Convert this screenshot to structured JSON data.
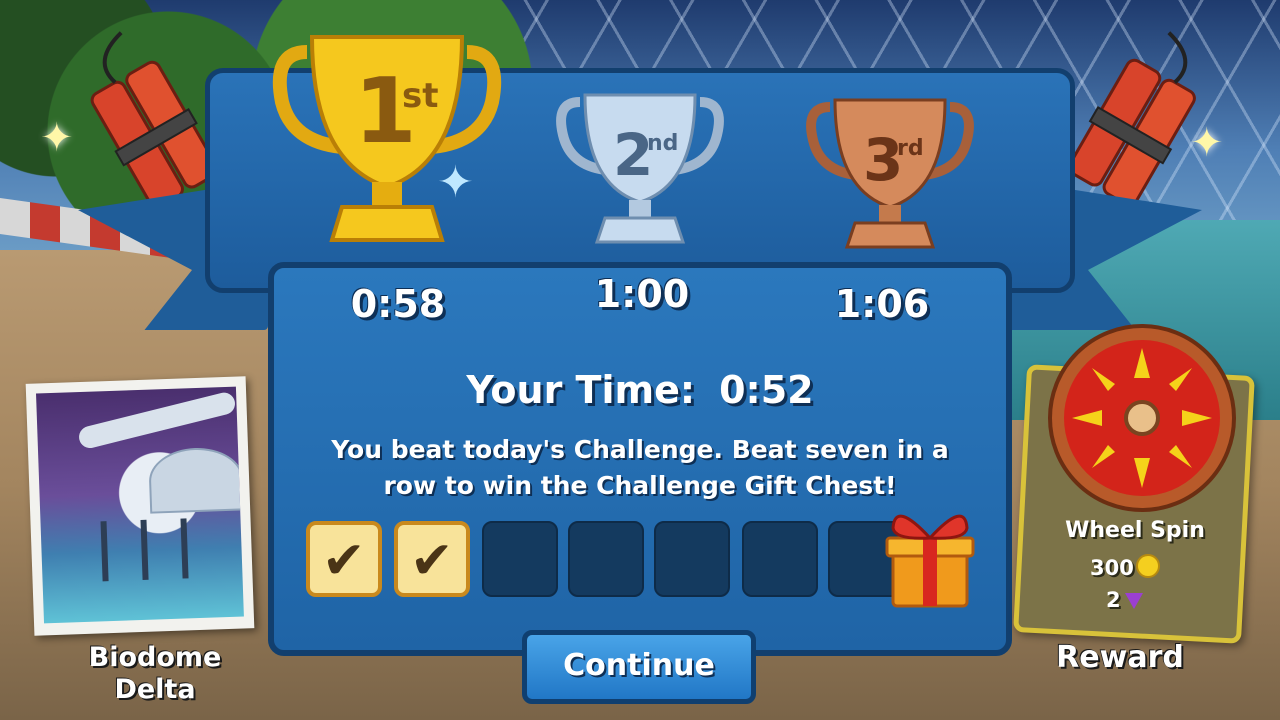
{
  "trophies": [
    {
      "rank": "1st",
      "num": "1",
      "suffix": "st",
      "time": "0:58",
      "color": "#f2c21b"
    },
    {
      "rank": "2nd",
      "num": "2",
      "suffix": "nd",
      "time": "1:00",
      "color": "#b9cfe6"
    },
    {
      "rank": "3rd",
      "num": "3",
      "suffix": "rd",
      "time": "1:06",
      "color": "#c9764a"
    }
  ],
  "result": {
    "your_time_label": "Your Time:",
    "your_time_value": "0:52",
    "message": "You beat today's Challenge.  Beat seven in a row to win the Challenge Gift Chest!"
  },
  "streak": {
    "completed": 2,
    "total": 7
  },
  "continue_label": "Continue",
  "track": {
    "name_line1": "Biodome",
    "name_line2": "Delta"
  },
  "reward": {
    "title": "Wheel Spin",
    "coins": "300",
    "gems": "2",
    "label": "Reward"
  },
  "colors": {
    "panel": "#2a73b8",
    "border": "#123f6e",
    "check_slot": "#f8e39a"
  },
  "icons": [
    "gold-trophy-icon",
    "silver-trophy-icon",
    "bronze-trophy-icon",
    "checkmark-icon",
    "gift-chest-icon",
    "coin-icon",
    "gem-icon",
    "dynamite-icon",
    "wheel-icon"
  ]
}
